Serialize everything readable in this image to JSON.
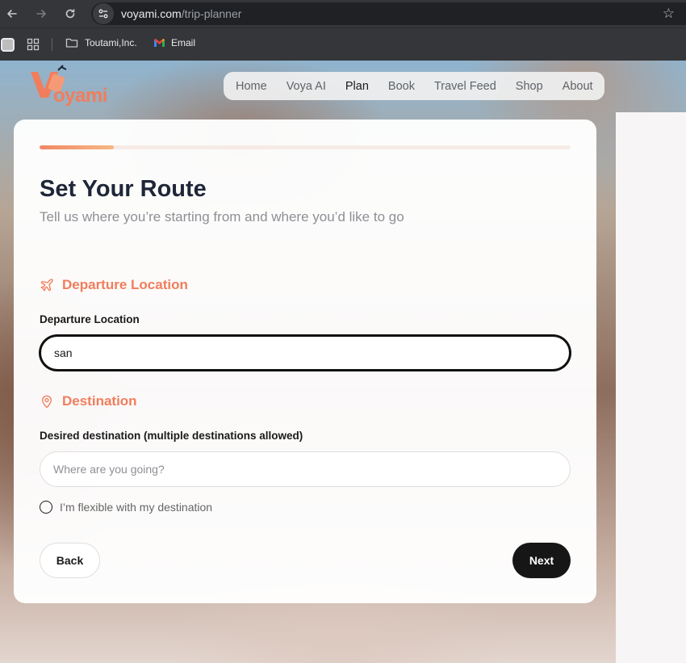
{
  "browser": {
    "url_host": "voyami.com",
    "url_path": "/trip-planner",
    "bookmarks": [
      {
        "label": "Toutami,Inc."
      },
      {
        "label": "Email"
      }
    ]
  },
  "brand": {
    "logo_text": "oyami",
    "accent_color": "#f27d5b"
  },
  "nav": {
    "items": [
      {
        "label": "Home"
      },
      {
        "label": "Voya AI"
      },
      {
        "label": "Plan"
      },
      {
        "label": "Book"
      },
      {
        "label": "Travel Feed"
      },
      {
        "label": "Shop"
      },
      {
        "label": "About"
      }
    ],
    "active": "Plan"
  },
  "progress": {
    "value": 0.14
  },
  "form": {
    "title": "Set Your Route",
    "subtitle": "Tell us where you’re starting from and where you’d like to go",
    "departure": {
      "section_title": "Departure Location",
      "label": "Departure Location",
      "value": "san"
    },
    "destination": {
      "section_title": "Destination",
      "label": "Desired destination (multiple destinations allowed)",
      "placeholder": "Where are you going?",
      "value": ""
    },
    "flexible": {
      "label": "I’m flexible with my destination",
      "checked": false
    },
    "back_label": "Back",
    "next_label": "Next"
  }
}
